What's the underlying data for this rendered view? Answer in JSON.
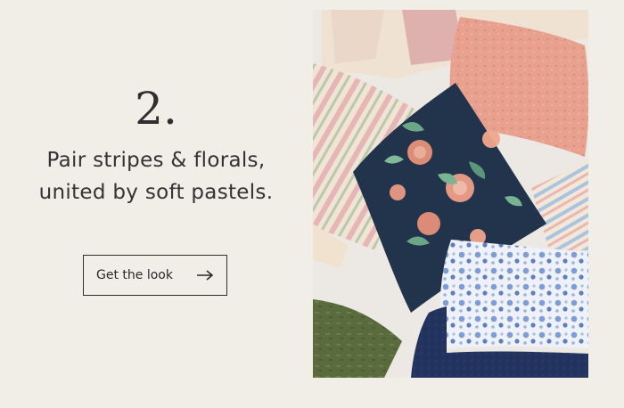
{
  "promo": {
    "step_number": "2.",
    "headline": "Pair stripes & florals, united by soft pastels.",
    "cta_label": "Get the look",
    "cta_icon": "arrow-right-icon"
  },
  "image": {
    "subject": "pillows-photo",
    "colors": {
      "background": "#f1ede7",
      "navy_floral": "#22334c",
      "pink_velvet": "#e8a08f",
      "blue_floral": "#7f9dd3",
      "green_velvet": "#5a6b3d",
      "stripe_pink": "#e8bfc0"
    }
  }
}
